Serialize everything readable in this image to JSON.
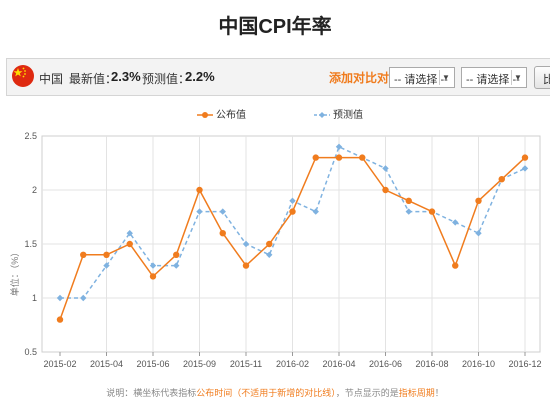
{
  "page": {
    "title": "中国CPI年率"
  },
  "toolbar": {
    "country": "中国",
    "latest_label": "最新值：",
    "latest_value": "2.3%",
    "forecast_label": "预测值：",
    "forecast_value": "2.2%",
    "add_compare": "添加对比对象：",
    "select1": "-- 请选择 --",
    "select2": "-- 请选择 --",
    "compare_button": "比较"
  },
  "footnote": {
    "p1": "说明：横坐标代表指标",
    "p2": "公布时间",
    "p3": "（不适用于新增的对比线）",
    "p4": "，节点显示的是",
    "p5": "指标周期",
    "p6": "！"
  },
  "colors": {
    "actual": "#f07c1e",
    "forecast": "#7fb2e0",
    "accent": "#f07c1e"
  },
  "chart_data": {
    "type": "line",
    "title": "",
    "xlabel": "",
    "ylabel": "单位：（%）",
    "ylim": [
      0.5,
      2.5
    ],
    "yticks": [
      "0.5",
      "1",
      "1.5",
      "2",
      "2.5"
    ],
    "x_tick_labels": [
      "2015-02",
      "2015-04",
      "2015-06",
      "2015-09",
      "2015-11",
      "2016-02",
      "2016-04",
      "2016-06",
      "2016-08",
      "2016-10",
      "2016-12"
    ],
    "legend_position": "top-center",
    "grid": true,
    "series": [
      {
        "name": "公布值",
        "values": [
          0.8,
          1.4,
          1.4,
          1.5,
          1.2,
          1.4,
          2.0,
          1.6,
          1.3,
          1.5,
          1.8,
          2.3,
          2.3,
          2.3,
          2.0,
          1.9,
          1.8,
          1.3,
          1.9,
          2.1,
          2.3
        ]
      },
      {
        "name": "预测值",
        "values": [
          1.0,
          1.0,
          1.3,
          1.6,
          1.3,
          1.3,
          1.8,
          1.8,
          1.5,
          1.4,
          1.9,
          1.8,
          2.4,
          2.3,
          2.2,
          1.8,
          1.8,
          1.7,
          1.6,
          2.1,
          2.2
        ]
      }
    ]
  }
}
